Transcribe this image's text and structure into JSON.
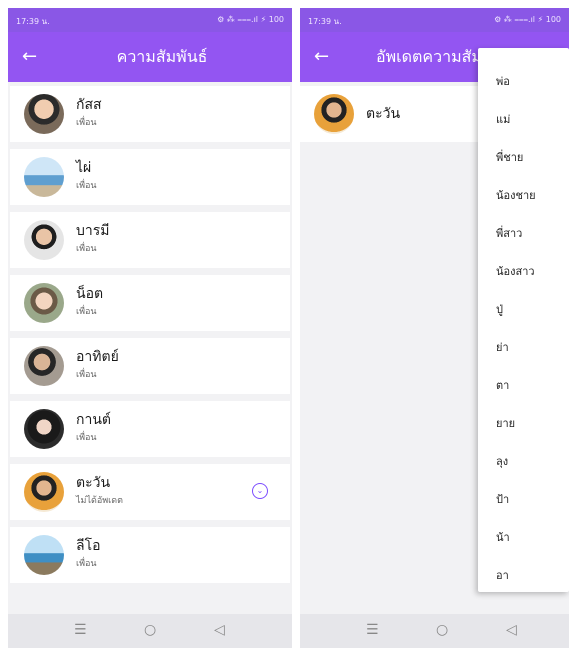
{
  "colors": {
    "appbar": "#9355f2",
    "status": "#8a57e6",
    "accent": "#7c4dff"
  },
  "left_screen": {
    "status_time": "17:39 น.",
    "status_icons": "⚙ ⁂ ⩶.ıl ⚡ 100",
    "title": "ความสัมพันธ์",
    "back_icon": "arrow-left-icon",
    "contacts": [
      {
        "name": "กัสส",
        "relation": "เพื่อน"
      },
      {
        "name": "ไผ่",
        "relation": "เพื่อน"
      },
      {
        "name": "บารมี",
        "relation": "เพื่อน"
      },
      {
        "name": "น็อต",
        "relation": "เพื่อน"
      },
      {
        "name": "อาทิตย์",
        "relation": "เพื่อน"
      },
      {
        "name": "กานต์",
        "relation": "เพื่อน"
      },
      {
        "name": "ตะวัน",
        "relation": "ไม่ได้อัพเดต",
        "expand_icon": "chevron-down-circle-icon"
      },
      {
        "name": "ลีโอ",
        "relation": "เพื่อน"
      }
    ],
    "nav": {
      "recents": "☰",
      "home": "○",
      "back": "◁"
    }
  },
  "right_screen": {
    "status_time": "17:39 น.",
    "status_icons": "⚙ ⁂ ⩶.ıl ⚡ 100",
    "title": "อัพเดตความสัมพ",
    "selected_contact": "ตะวัน",
    "menu_options": [
      "พ่อ",
      "แม่",
      "พี่ชาย",
      "น้องชาย",
      "พี่สาว",
      "น้องสาว",
      "ปู่",
      "ย่า",
      "ตา",
      "ยาย",
      "ลุง",
      "ป้า",
      "น้า",
      "อา"
    ],
    "nav": {
      "recents": "☰",
      "home": "○",
      "back": "◁"
    }
  }
}
